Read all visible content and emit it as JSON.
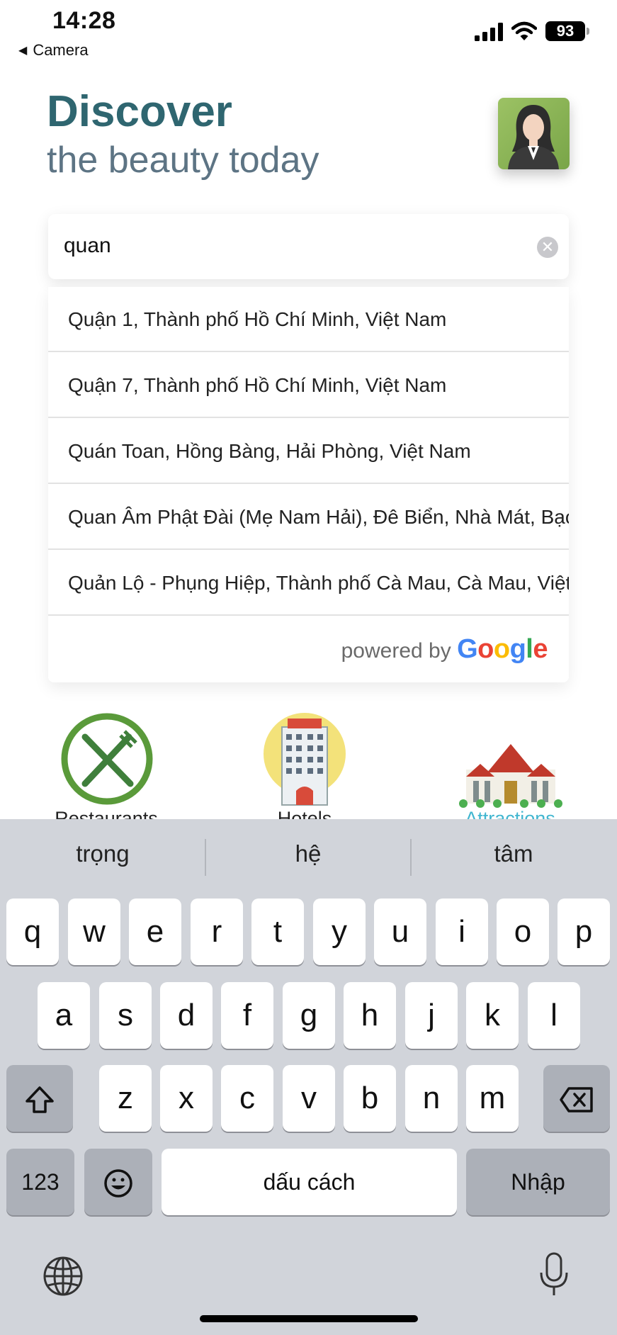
{
  "status": {
    "time": "14:28",
    "back_label": "Camera",
    "battery": "93"
  },
  "header": {
    "title": "Discover",
    "subtitle": "the beauty today"
  },
  "search": {
    "value": "quan",
    "clear_glyph": "✕"
  },
  "suggestions": [
    "Quận 1, Thành phố Hồ Chí Minh, Việt Nam",
    "Quận 7, Thành phố Hồ Chí Minh, Việt Nam",
    "Quán Toan, Hồng Bàng, Hải Phòng, Việt Nam",
    "Quan Âm Phật Đài (Mẹ Nam Hải), Đê Biển, Nhà Mát, Bạc Liêu",
    "Quản Lộ - Phụng Hiệp, Thành phố Cà Mau, Cà Mau, Việt Nam"
  ],
  "powered_by": {
    "prefix": "powered by",
    "brand_letters": [
      "G",
      "o",
      "o",
      "g",
      "l",
      "e"
    ]
  },
  "categories": {
    "restaurants": "Restaurants",
    "hotels": "Hotels",
    "attractions": "Attractions"
  },
  "keyboard": {
    "suggestions": [
      "trọng",
      "hệ",
      "tâm"
    ],
    "row1": [
      "q",
      "w",
      "e",
      "r",
      "t",
      "y",
      "u",
      "i",
      "o",
      "p"
    ],
    "row2": [
      "a",
      "s",
      "d",
      "f",
      "g",
      "h",
      "j",
      "k",
      "l"
    ],
    "row3": [
      "z",
      "x",
      "c",
      "v",
      "b",
      "n",
      "m"
    ],
    "numbers_label": "123",
    "space_label": "dấu cách",
    "return_label": "Nhập"
  },
  "colors": {
    "title": "#2f6670",
    "subtitle": "#5d7484",
    "attractions": "#41b6d0",
    "keyboard_bg": "#d1d4da"
  },
  "icons": [
    "signal-icon",
    "wifi-icon",
    "battery-icon",
    "clear-icon",
    "shift-icon",
    "delete-icon",
    "emoji-icon",
    "globe-icon",
    "microphone-icon"
  ]
}
